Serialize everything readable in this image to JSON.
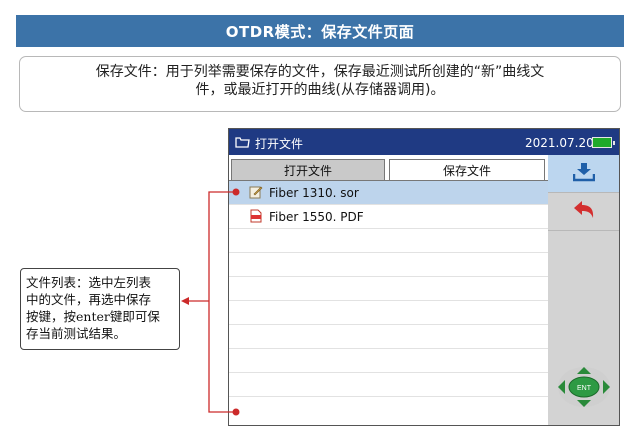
{
  "header": {
    "title": "OTDR模式：保存文件页面"
  },
  "description": {
    "line1": "保存文件：用于列举需要保存的文件，保存最近测试所创建的“新”曲线文",
    "line2": "件，或最近打开的曲线(从存储器调用)。"
  },
  "device": {
    "title": "打开文件",
    "date": "2021.07.20",
    "tabs": [
      {
        "label": "打开文件",
        "active": false
      },
      {
        "label": "保存文件",
        "active": true
      }
    ],
    "files": [
      {
        "name": "Fiber 1310. sor",
        "icon": "trace-file-icon",
        "selected": true
      },
      {
        "name": "Fiber 1550. PDF",
        "icon": "pdf-file-icon",
        "selected": false
      }
    ],
    "side_buttons": [
      {
        "icon": "save-download-icon"
      },
      {
        "icon": "return-arrow-icon"
      }
    ],
    "nav_pad_label": "ENT"
  },
  "callout": {
    "lines": [
      "文件列表：选中左列表",
      "中的文件，再选中保存",
      "按键，按enter键即可保",
      "存当前测试结果。"
    ]
  },
  "colors": {
    "header_bg": "#3c73a8",
    "title_bar_bg": "#1f3a83",
    "selected_row": "#bdd4ec",
    "callout_line": "#cc2a2a",
    "battery": "#1faa2a"
  }
}
